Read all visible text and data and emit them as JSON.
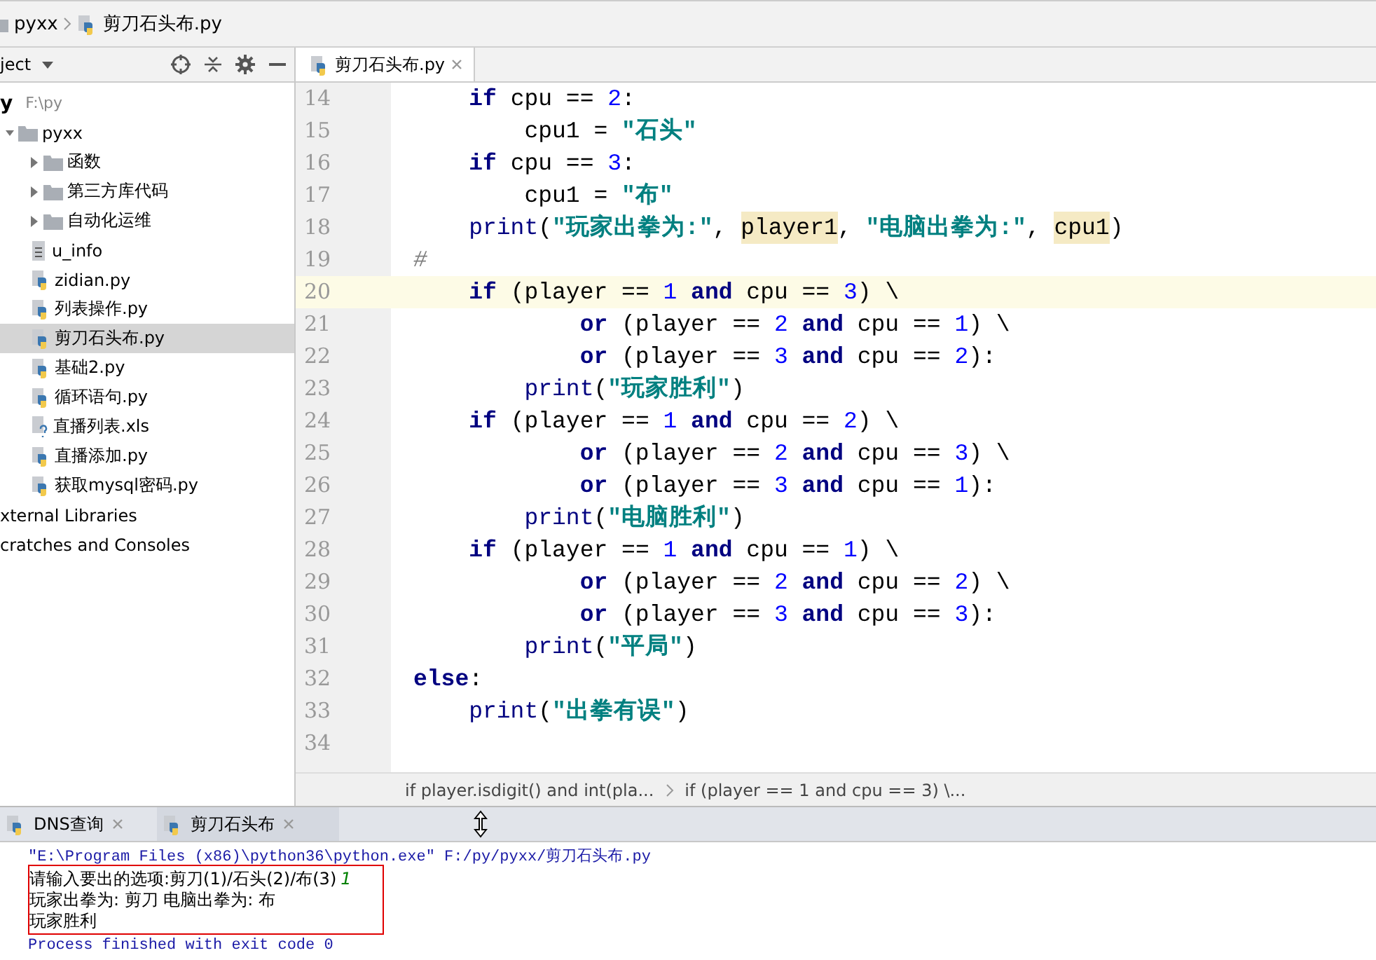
{
  "breadcrumb": {
    "items": [
      {
        "kind": "folder",
        "label": "pyxx"
      },
      {
        "kind": "python",
        "label": "剪刀石头布.py"
      }
    ]
  },
  "project_panel": {
    "title": "ject",
    "tree": [
      {
        "label": "y",
        "path": "F:\\py",
        "kind": "root",
        "bold": true,
        "selected": false,
        "children": [
          {
            "label": "pyxx",
            "kind": "folder",
            "expanded": true,
            "selected": false,
            "children": [
              {
                "label": "函数",
                "kind": "folder",
                "expanded": false,
                "selected": false
              },
              {
                "label": "第三方库代码",
                "kind": "folder",
                "expanded": false,
                "selected": false
              },
              {
                "label": "自动化运维",
                "kind": "folder",
                "expanded": false,
                "selected": false
              },
              {
                "label": "u_info",
                "kind": "text",
                "selected": false
              },
              {
                "label": "zidian.py",
                "kind": "python",
                "selected": false
              },
              {
                "label": "列表操作.py",
                "kind": "python",
                "selected": false
              },
              {
                "label": "剪刀石头布.py",
                "kind": "python",
                "selected": true
              },
              {
                "label": "基础2.py",
                "kind": "python",
                "selected": false
              },
              {
                "label": "循环语句.py",
                "kind": "python",
                "selected": false
              },
              {
                "label": "直播列表.xls",
                "kind": "unknown",
                "selected": false
              },
              {
                "label": "直播添加.py",
                "kind": "python",
                "selected": false
              },
              {
                "label": "获取mysql密码.py",
                "kind": "python",
                "selected": false
              }
            ]
          }
        ]
      },
      {
        "label": "xternal Libraries",
        "kind": "plain",
        "selected": false
      },
      {
        "label": "cratches and Consoles",
        "kind": "plain",
        "selected": false
      }
    ]
  },
  "editor": {
    "tabs": [
      {
        "label": "剪刀石头布.py",
        "selected": true
      }
    ],
    "lines": [
      {
        "number": "14",
        "current": false,
        "tokens": [
          {
            "kind": "kw",
            "text": "    if"
          },
          {
            "kind": "plain",
            "text": " cpu == "
          },
          {
            "kind": "num",
            "text": "2"
          },
          {
            "kind": "plain",
            "text": ":"
          }
        ]
      },
      {
        "number": "15",
        "current": false,
        "tokens": [
          {
            "kind": "plain",
            "text": "        cpu1 = "
          },
          {
            "kind": "str",
            "text": "\"石头\""
          }
        ]
      },
      {
        "number": "16",
        "current": false,
        "tokens": [
          {
            "kind": "kw",
            "text": "    if"
          },
          {
            "kind": "plain",
            "text": " cpu == "
          },
          {
            "kind": "num",
            "text": "3"
          },
          {
            "kind": "plain",
            "text": ":"
          }
        ]
      },
      {
        "number": "17",
        "current": false,
        "tokens": [
          {
            "kind": "plain",
            "text": "        cpu1 = "
          },
          {
            "kind": "str",
            "text": "\"布\""
          }
        ]
      },
      {
        "number": "18",
        "current": false,
        "tokens": [
          {
            "kind": "builtin",
            "text": "    print"
          },
          {
            "kind": "plain",
            "text": "("
          },
          {
            "kind": "str",
            "text": "\"玩家出拳为:\""
          },
          {
            "kind": "plain",
            "text": ", "
          },
          {
            "kind": "hl",
            "text": "player1"
          },
          {
            "kind": "plain",
            "text": ", "
          },
          {
            "kind": "str",
            "text": "\"电脑出拳为:\""
          },
          {
            "kind": "plain",
            "text": ", "
          },
          {
            "kind": "hl",
            "text": "cpu1"
          },
          {
            "kind": "plain",
            "text": ")"
          }
        ]
      },
      {
        "number": "19",
        "current": false,
        "tokens": [
          {
            "kind": "comment",
            "text": "#"
          }
        ]
      },
      {
        "number": "20",
        "current": true,
        "tokens": [
          {
            "kind": "kw",
            "text": "    if"
          },
          {
            "kind": "plain",
            "text": " (player == "
          },
          {
            "kind": "num",
            "text": "1"
          },
          {
            "kind": "kw",
            "text": " and"
          },
          {
            "kind": "plain",
            "text": " cpu == "
          },
          {
            "kind": "num",
            "text": "3"
          },
          {
            "kind": "plain",
            "text": ") \\"
          }
        ]
      },
      {
        "number": "21",
        "current": false,
        "tokens": [
          {
            "kind": "kw",
            "text": "            or"
          },
          {
            "kind": "plain",
            "text": " (player == "
          },
          {
            "kind": "num",
            "text": "2"
          },
          {
            "kind": "kw",
            "text": " and"
          },
          {
            "kind": "plain",
            "text": " cpu == "
          },
          {
            "kind": "num",
            "text": "1"
          },
          {
            "kind": "plain",
            "text": ") \\"
          }
        ]
      },
      {
        "number": "22",
        "current": false,
        "tokens": [
          {
            "kind": "kw",
            "text": "            or"
          },
          {
            "kind": "plain",
            "text": " (player == "
          },
          {
            "kind": "num",
            "text": "3"
          },
          {
            "kind": "kw",
            "text": " and"
          },
          {
            "kind": "plain",
            "text": " cpu == "
          },
          {
            "kind": "num",
            "text": "2"
          },
          {
            "kind": "plain",
            "text": "):"
          }
        ]
      },
      {
        "number": "23",
        "current": false,
        "tokens": [
          {
            "kind": "builtin",
            "text": "        print"
          },
          {
            "kind": "plain",
            "text": "("
          },
          {
            "kind": "str",
            "text": "\"玩家胜利\""
          },
          {
            "kind": "plain",
            "text": ")"
          }
        ]
      },
      {
        "number": "24",
        "current": false,
        "tokens": [
          {
            "kind": "kw",
            "text": "    if"
          },
          {
            "kind": "plain",
            "text": " (player == "
          },
          {
            "kind": "num",
            "text": "1"
          },
          {
            "kind": "kw",
            "text": " and"
          },
          {
            "kind": "plain",
            "text": " cpu == "
          },
          {
            "kind": "num",
            "text": "2"
          },
          {
            "kind": "plain",
            "text": ") \\"
          }
        ]
      },
      {
        "number": "25",
        "current": false,
        "tokens": [
          {
            "kind": "kw",
            "text": "            or"
          },
          {
            "kind": "plain",
            "text": " (player == "
          },
          {
            "kind": "num",
            "text": "2"
          },
          {
            "kind": "kw",
            "text": " and"
          },
          {
            "kind": "plain",
            "text": " cpu == "
          },
          {
            "kind": "num",
            "text": "3"
          },
          {
            "kind": "plain",
            "text": ") \\"
          }
        ]
      },
      {
        "number": "26",
        "current": false,
        "tokens": [
          {
            "kind": "kw",
            "text": "            or"
          },
          {
            "kind": "plain",
            "text": " (player == "
          },
          {
            "kind": "num",
            "text": "3"
          },
          {
            "kind": "kw",
            "text": " and"
          },
          {
            "kind": "plain",
            "text": " cpu == "
          },
          {
            "kind": "num",
            "text": "1"
          },
          {
            "kind": "plain",
            "text": "):"
          }
        ]
      },
      {
        "number": "27",
        "current": false,
        "tokens": [
          {
            "kind": "builtin",
            "text": "        print"
          },
          {
            "kind": "plain",
            "text": "("
          },
          {
            "kind": "str",
            "text": "\"电脑胜利\""
          },
          {
            "kind": "plain",
            "text": ")"
          }
        ]
      },
      {
        "number": "28",
        "current": false,
        "tokens": [
          {
            "kind": "kw",
            "text": "    if"
          },
          {
            "kind": "plain",
            "text": " (player == "
          },
          {
            "kind": "num",
            "text": "1"
          },
          {
            "kind": "kw",
            "text": " and"
          },
          {
            "kind": "plain",
            "text": " cpu == "
          },
          {
            "kind": "num",
            "text": "1"
          },
          {
            "kind": "plain",
            "text": ") \\"
          }
        ]
      },
      {
        "number": "29",
        "current": false,
        "tokens": [
          {
            "kind": "kw",
            "text": "            or"
          },
          {
            "kind": "plain",
            "text": " (player == "
          },
          {
            "kind": "num",
            "text": "2"
          },
          {
            "kind": "kw",
            "text": " and"
          },
          {
            "kind": "plain",
            "text": " cpu == "
          },
          {
            "kind": "num",
            "text": "2"
          },
          {
            "kind": "plain",
            "text": ") \\"
          }
        ]
      },
      {
        "number": "30",
        "current": false,
        "tokens": [
          {
            "kind": "kw",
            "text": "            or"
          },
          {
            "kind": "plain",
            "text": " (player == "
          },
          {
            "kind": "num",
            "text": "3"
          },
          {
            "kind": "kw",
            "text": " and"
          },
          {
            "kind": "plain",
            "text": " cpu == "
          },
          {
            "kind": "num",
            "text": "3"
          },
          {
            "kind": "plain",
            "text": "):"
          }
        ]
      },
      {
        "number": "31",
        "current": false,
        "tokens": [
          {
            "kind": "builtin",
            "text": "        print"
          },
          {
            "kind": "plain",
            "text": "("
          },
          {
            "kind": "str",
            "text": "\"平局\""
          },
          {
            "kind": "plain",
            "text": ")"
          }
        ]
      },
      {
        "number": "32",
        "current": false,
        "tokens": [
          {
            "kind": "kw",
            "text": "else"
          },
          {
            "kind": "plain",
            "text": ":"
          }
        ]
      },
      {
        "number": "33",
        "current": false,
        "tokens": [
          {
            "kind": "builtin",
            "text": "    print"
          },
          {
            "kind": "plain",
            "text": "("
          },
          {
            "kind": "str",
            "text": "\"出拳有误\""
          },
          {
            "kind": "plain",
            "text": ")"
          }
        ]
      },
      {
        "number": "34",
        "current": false
      }
    ],
    "code_breadcrumb": [
      "if player.isdigit() and int(pla...",
      "if (player == 1 and cpu == 3) \\..."
    ]
  },
  "run_panel": {
    "tabs": [
      {
        "label": "DNS查询",
        "selected": false
      },
      {
        "label": "剪刀石头布",
        "selected": true
      }
    ],
    "console": {
      "command": "\"E:\\Program Files (x86)\\python36\\python.exe\" F:/py/pyxx/剪刀石头布.py",
      "output": [
        {
          "kind": "prompt",
          "text": "请输入要出的选项:剪刀(1)/石头(2)/布(3)",
          "input": "1"
        },
        {
          "kind": "text",
          "text": "玩家出拳为: 剪刀 电脑出拳为: 布"
        },
        {
          "kind": "text",
          "text": "玩家胜利"
        }
      ],
      "footer": "Process finished with exit code 0"
    }
  }
}
